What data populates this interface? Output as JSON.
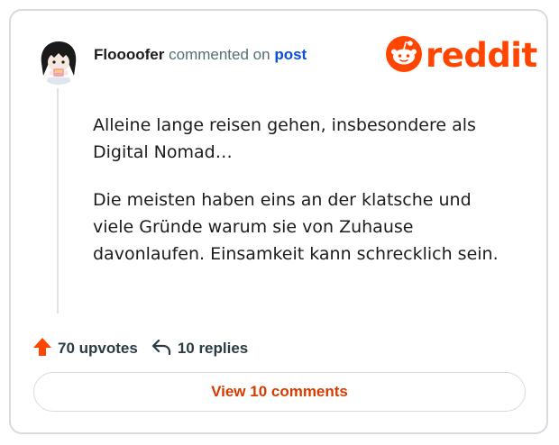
{
  "comment": {
    "author": "Floooofer",
    "action_text": "commented on",
    "post_link": "post",
    "paragraphs": [
      "Alleine lange reisen gehen, insbesondere als Digital Nomad…",
      "Die meisten haben eins an der klatsche und viele Gründe warum sie von Zuhause davonlaufen. Einsamkeit kann schrecklich sein."
    ]
  },
  "brand": {
    "name": "reddit",
    "color": "#ff4500"
  },
  "stats": {
    "upvotes": "70 upvotes",
    "replies": "10 replies"
  },
  "actions": {
    "view_comments": "View 10 comments"
  },
  "colors": {
    "upvote": "#ff4500",
    "link": "#0a4fd6",
    "button_text": "#d93a00"
  },
  "icons": {
    "avatar": "avatar",
    "logo": "reddit-snoo-icon",
    "upvote": "upvote-arrow-icon",
    "reply": "reply-arrow-icon"
  }
}
